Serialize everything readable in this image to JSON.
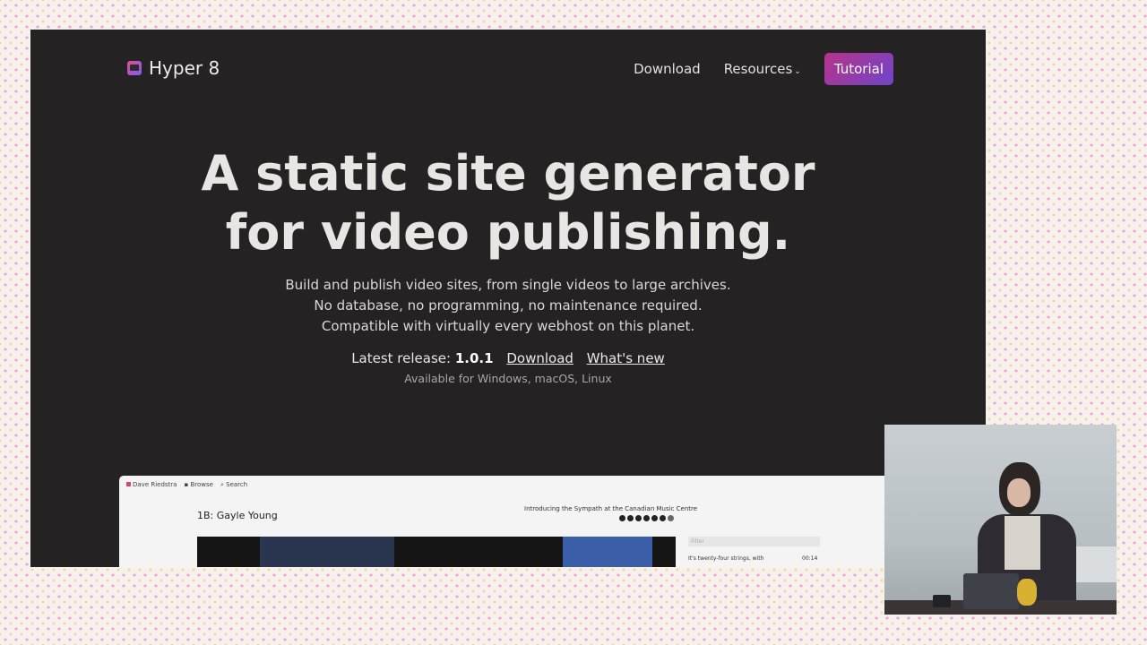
{
  "site": {
    "logo": "Hyper 8",
    "nav": {
      "download": "Download",
      "resources": "Resources",
      "tutorial": "Tutorial"
    }
  },
  "hero": {
    "title_line1": "A static site generator",
    "title_line2": "for video publishing.",
    "sub1": "Build and publish video sites, from single videos to large archives.",
    "sub2": "No database, no programming, no maintenance required.",
    "sub3": "Compatible with virtually every webhost on this planet."
  },
  "release": {
    "label": "Latest release:",
    "version": "1.0.1",
    "download": "Download",
    "whats_new": "What's new",
    "platforms": "Available for Windows, macOS, Linux"
  },
  "preview": {
    "nav_site": "Dave Riedstra",
    "nav_browse": "Browse",
    "nav_search": "Search",
    "title": "1B: Gayle Young",
    "caption": "Introducing the Sympath at the Canadian Music Centre",
    "filter": "Filter",
    "item": "It's twenty-four strings, with",
    "time": "00:14"
  },
  "colors": {
    "accent_start": "#b7338a",
    "accent_end": "#6f45c9",
    "slide_bg": "#242222"
  }
}
